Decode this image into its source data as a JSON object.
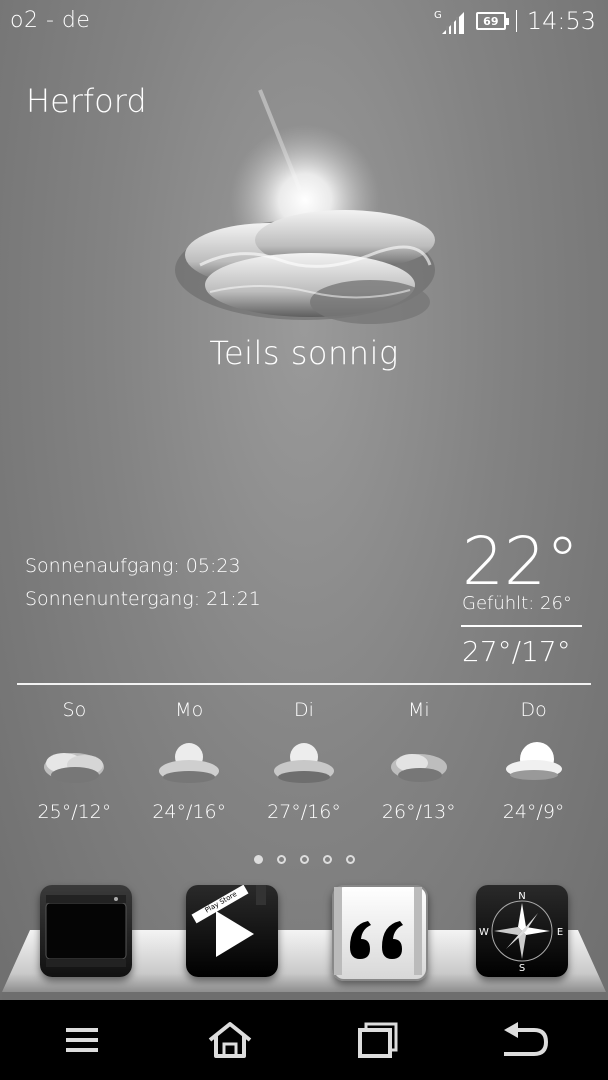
{
  "status_bar": {
    "carrier": "o2 - de",
    "signal_icon": "signal-icon",
    "network_type": "G",
    "battery_level": "69",
    "time": "14:53"
  },
  "weather": {
    "city": "Herford",
    "condition": "Teils sonnig",
    "condition_icon": "partly-sunny-icon",
    "sunrise": "Sonnenaufgang: 05:23",
    "sunset": "Sonnenuntergang: 21:21",
    "temperature": "22°",
    "feels_like": "Gefühlt: 26°",
    "high_low": "27°/17°"
  },
  "forecast": [
    {
      "day": "So",
      "temp": "25°/12°",
      "icon": "cloudy-icon"
    },
    {
      "day": "Mo",
      "temp": "24°/16°",
      "icon": "partly-sunny-icon"
    },
    {
      "day": "Di",
      "temp": "27°/16°",
      "icon": "partly-sunny-icon"
    },
    {
      "day": "Mi",
      "temp": "26°/13°",
      "icon": "cloudy-icon"
    },
    {
      "day": "Do",
      "temp": "24°/9°",
      "icon": "sunny-cloud-icon"
    }
  ],
  "pager": {
    "pages": 5,
    "active_index": 0
  },
  "dock": {
    "apps": [
      {
        "name": "phone-app",
        "icon": "phone-icon"
      },
      {
        "name": "play-store-app",
        "icon": "play-icon",
        "label": "Play Store"
      },
      {
        "name": "quotes-app",
        "icon": "quote-icon"
      },
      {
        "name": "compass-app",
        "icon": "compass-icon",
        "letters": [
          "N",
          "E",
          "S",
          "W"
        ]
      }
    ]
  },
  "nav_bar": [
    "menu-icon",
    "home-icon",
    "recents-icon",
    "back-icon"
  ]
}
